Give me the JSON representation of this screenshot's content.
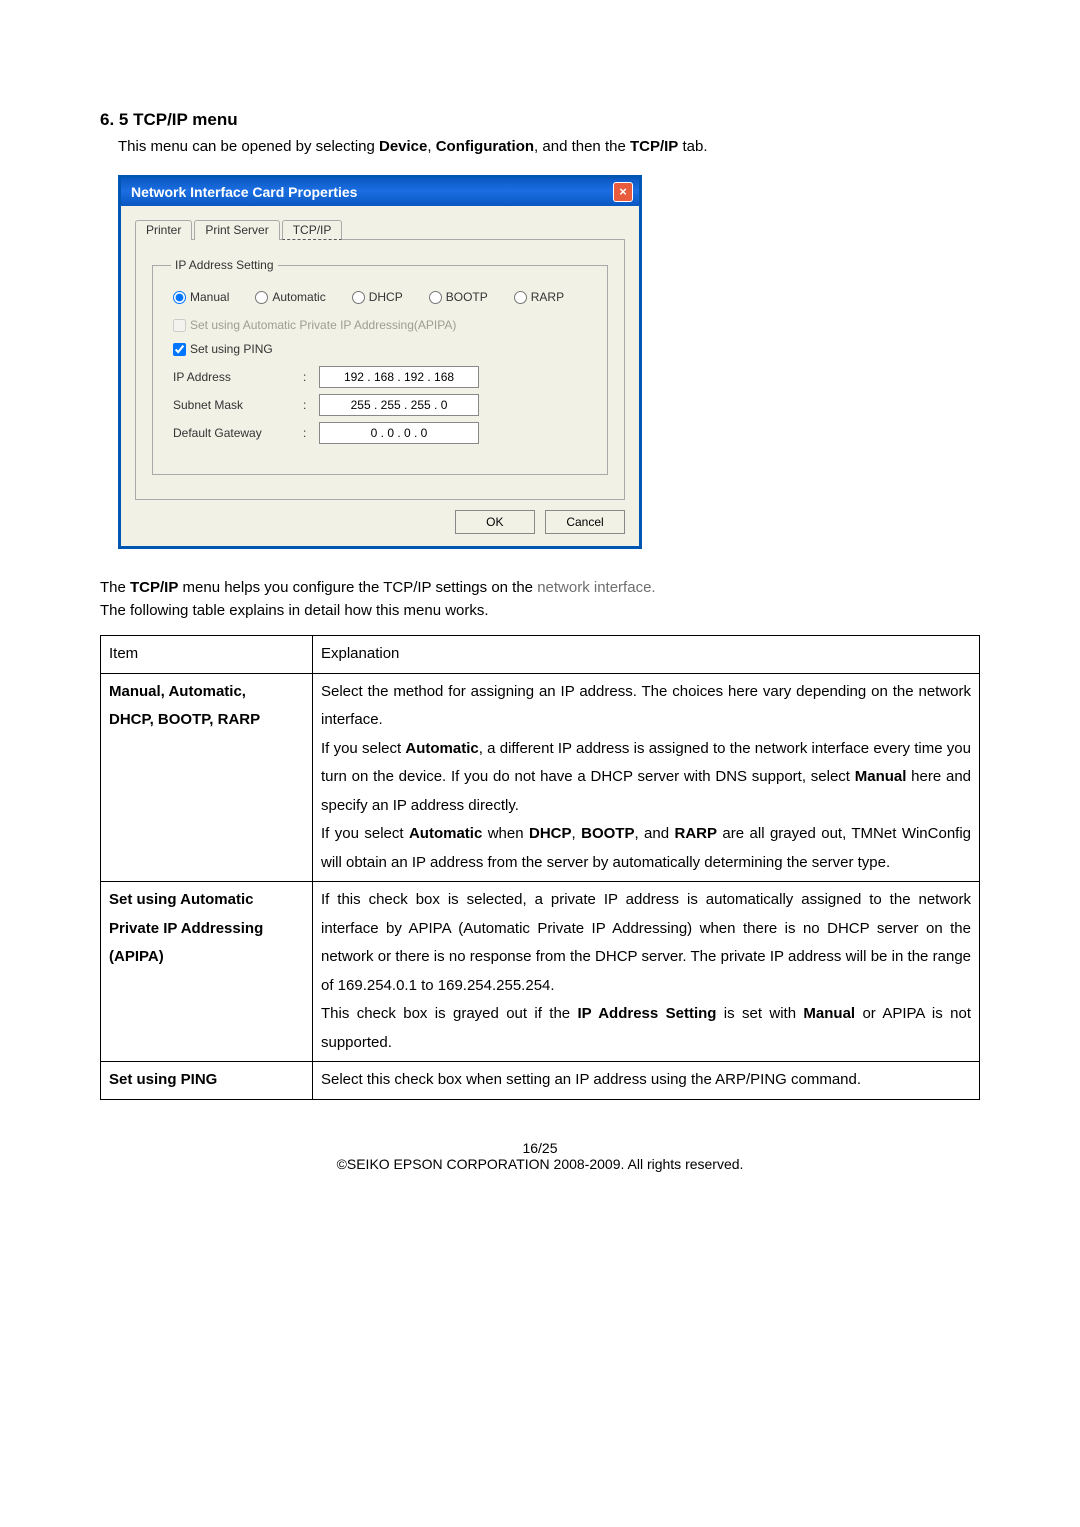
{
  "heading": "6. 5 TCP/IP menu",
  "introPrefix": "This menu can be opened by selecting ",
  "introBold1": "Device",
  "introMid1": ", ",
  "introBold2": "Configuration",
  "introMid2": ", and then the ",
  "introBold3": "TCP/IP",
  "introSuffix": " tab.",
  "dialog": {
    "title": "Network Interface Card Properties",
    "close": "×",
    "tabs": {
      "printer": "Printer",
      "printServer": "Print Server",
      "tcpip": "TCP/IP"
    },
    "groupLegend": "IP Address Setting",
    "radios": {
      "manual": "Manual",
      "automatic": "Automatic",
      "dhcp": "DHCP",
      "bootp": "BOOTP",
      "rarp": "RARP"
    },
    "cbApipa": "Set using Automatic Private IP Addressing(APIPA)",
    "cbPing": "Set using PING",
    "lblIp": "IP Address",
    "lblMask": "Subnet Mask",
    "lblGw": "Default Gateway",
    "colon": ":",
    "ipVal": "192  .  168  .  192  .  168",
    "maskVal": "255  .  255  .  255  .    0",
    "gwVal": "0   .    0   .    0   .    0",
    "ok": "OK",
    "cancel": "Cancel"
  },
  "desc1a": "The ",
  "desc1b": "TCP/IP",
  "desc1c": " menu helps you configure the TCP/IP settings on the ",
  "desc1d": "network interface.",
  "desc2": "The following table explains in detail how this menu works.",
  "table": {
    "hItem": "Item",
    "hExpl": "Explanation",
    "r1Item1": "Manual, Automatic,",
    "r1Item2": "DHCP, BOOTP, RARP",
    "r1p1": "Select the method for assigning an IP address. The choices here vary depending on the network interface.",
    "r1p2a": "If you select ",
    "r1p2b": "Automatic",
    "r1p2c": ", a different IP address is assigned to the network interface every time you turn on the device. If you do not have a DHCP server with DNS support, select ",
    "r1p2d": "Manual",
    "r1p2e": " here and specify an IP address directly.",
    "r1p3a": "If you select ",
    "r1p3b": "Automatic",
    "r1p3c": " when ",
    "r1p3d": "DHCP",
    "r1p3e": ", ",
    "r1p3f": "BOOTP",
    "r1p3g": ", and ",
    "r1p3h": "RARP",
    "r1p3i": " are all grayed out, TMNet WinConfig will obtain an IP address from the server by automatically determining the server type.",
    "r2Item1": "Set using Automatic",
    "r2Item2": "Private IP Addressing",
    "r2Item3": "(APIPA)",
    "r2p1": "If this check box is selected, a private IP address is automatically assigned to the network interface by APIPA (Automatic Private IP Addressing) when there is no DHCP server on the network or there is no response from the DHCP server. The private IP address will be in the range of 169.254.0.1 to 169.254.255.254.",
    "r2p2a": "This check box is grayed out if the ",
    "r2p2b": "IP Address Setting",
    "r2p2c": " is set with ",
    "r2p2d": "Manual",
    "r2p2e": " or APIPA is not supported.",
    "r3Item": "Set using PING",
    "r3Expl": "Select this check box when setting an IP address using the ARP/PING command."
  },
  "footer": {
    "page": "16/25",
    "copyright": "©SEIKO EPSON CORPORATION 2008-2009. All rights reserved."
  }
}
